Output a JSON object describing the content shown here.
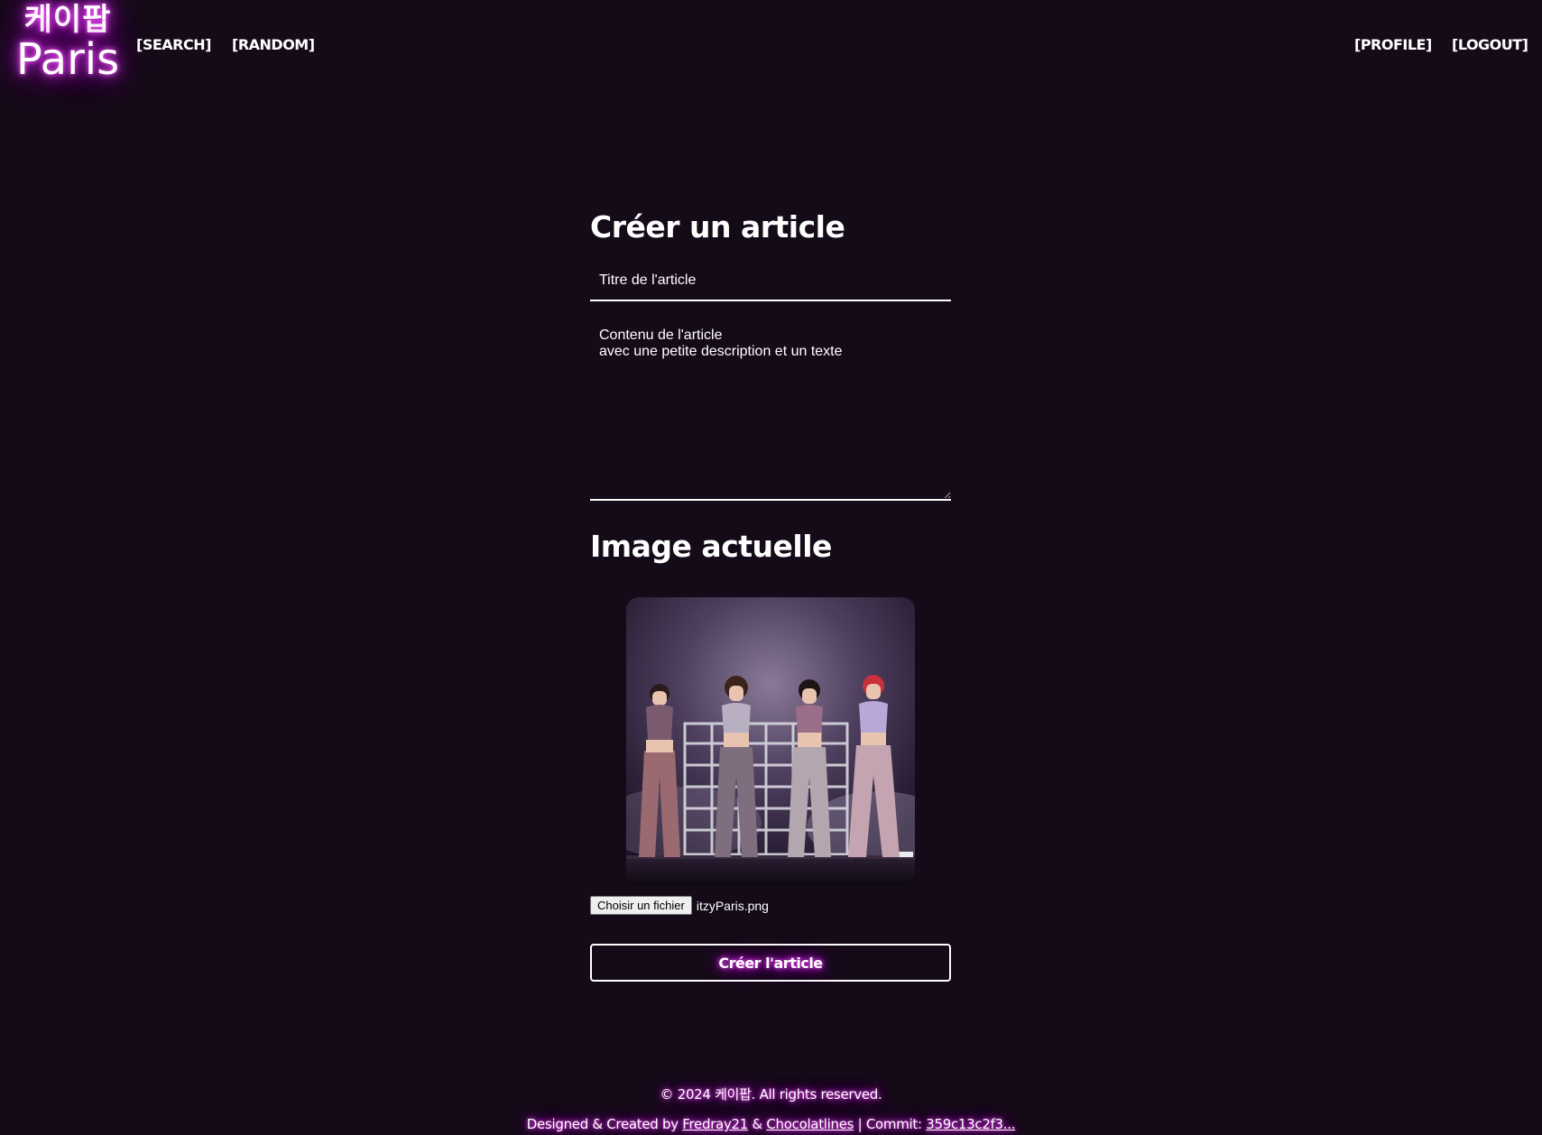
{
  "header": {
    "logo_korean": "케이팝",
    "logo_city": "Paris",
    "nav_left": [
      "[SEARCH]",
      "[RANDOM]"
    ],
    "nav_right": [
      "[PROFILE]",
      "[LOGOUT]"
    ]
  },
  "form": {
    "heading": "Créer un article",
    "title_value": "Titre de l'article",
    "content_value": "Contenu de l'article\navec une petite description et un texte",
    "image_heading": "Image actuelle",
    "file_button_label": "Choisir un fichier",
    "file_name": "itzyParis.png",
    "submit_label": "Créer l'article"
  },
  "footer": {
    "copyright": "© 2024 케이팝. All rights reserved.",
    "credits_prefix": "Designed & Created by",
    "author_1": "Fredray21",
    "credits_and": "&",
    "author_2": "Chocolatlines",
    "commit_label": "| Commit:",
    "commit_hash": "359c13c2f3..."
  },
  "colors": {
    "background": "#150a18",
    "neon_glow": "#e040fb",
    "text": "#ffffff"
  }
}
